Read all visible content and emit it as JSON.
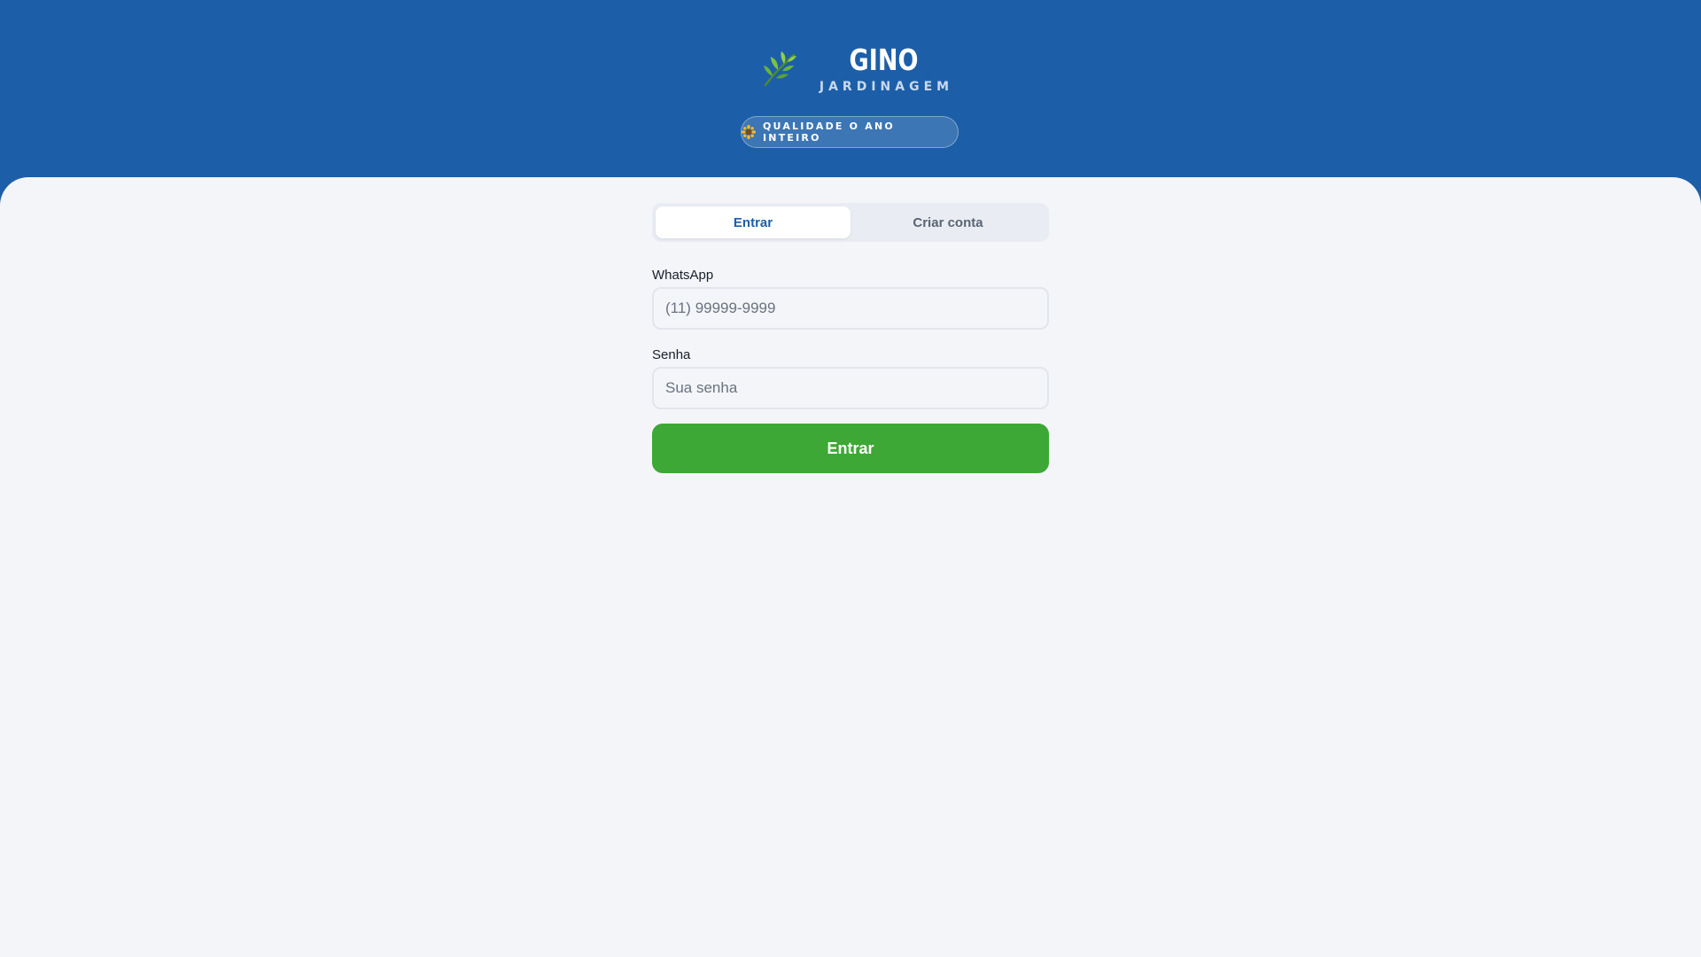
{
  "brand": {
    "title": "GINO",
    "subtitle": "JARDINAGEM",
    "logo_icon": "leaf-icon",
    "tagline": "QUALIDADE O ANO INTEIRO",
    "tagline_icon": "sunflower-icon"
  },
  "tabs": [
    {
      "label": "Entrar",
      "active": true
    },
    {
      "label": "Criar conta",
      "active": false
    }
  ],
  "form": {
    "whatsapp_label": "WhatsApp",
    "whatsapp_placeholder": "(11) 99999-9999",
    "whatsapp_value": "",
    "password_label": "Senha",
    "password_placeholder": "Sua senha",
    "password_value": "",
    "submit_label": "Entrar"
  },
  "colors": {
    "header_bg": "#1c5fa8",
    "content_bg": "#f3f5f9",
    "accent_green": "#3da835",
    "active_tab_text": "#1c5fa8"
  }
}
